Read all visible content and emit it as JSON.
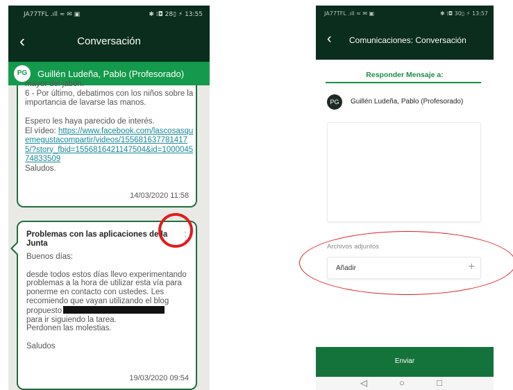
{
  "left": {
    "status_left": "JA77TFL .ıll ≈ ✉ ▣",
    "status_right": "✱ ⁞◘ 28▯ ⚡ 13:55",
    "header_title": "Conversación",
    "contact": {
      "initials": "PG",
      "name": "Guillén Ludeña, Pablo (Profesorado)"
    },
    "message1": {
      "body_top": "mayor del jabón.\n6 - Por último, debatimos con los niños sobre la importancia de lavarse las manos.\n\nEspero les haya parecido de interés.\nEl vídeo: ",
      "link": "https://www.facebook.com/lascosasquemegustacompartir/videos/1556816377814175/?story_fbid=1556816421147504&id=100004574833509",
      "body_bottom": "Saludos.",
      "time": "14/03/2020 11:58"
    },
    "message2": {
      "subject": "Problemas con las aplicaciones de la Junta",
      "body_a": "Buenos días:\n\ndesde todos estos días llevo experimentando problemas a la hora de utilizar esta vía para ponerme en contacto con ustedes. Les recomiendo que vayan utilizando el blog propuesto",
      "body_b": "para ir siguiendo la tarea.\nPerdonen las molestias.\n\nSaludos",
      "time": "19/03/2020 09:54"
    },
    "colors": {
      "header": "#0a2d1d",
      "contact_bar": "#149a4c",
      "highlight": "#e21b1b"
    }
  },
  "right": {
    "status_left": "JA77TFL .ıll ≈ ✉ ▣",
    "status_right": "✱ ⁞◘ 30▯ ⚡ 13:57",
    "header_title": "Comunicaciones: Conversación",
    "reply_title": "Responder Mensaje a:",
    "contact": {
      "initials": "PG",
      "name": "Guillén Ludeña, Pablo (Profesorado)"
    },
    "attachments_label": "Archivos adjuntos",
    "add_label": "Añadir",
    "send_label": "Enviar",
    "nav": {
      "back": "◁",
      "home": "○",
      "recent": "□"
    },
    "colors": {
      "accent": "#1a8e45",
      "send_bar": "#13733b"
    }
  }
}
